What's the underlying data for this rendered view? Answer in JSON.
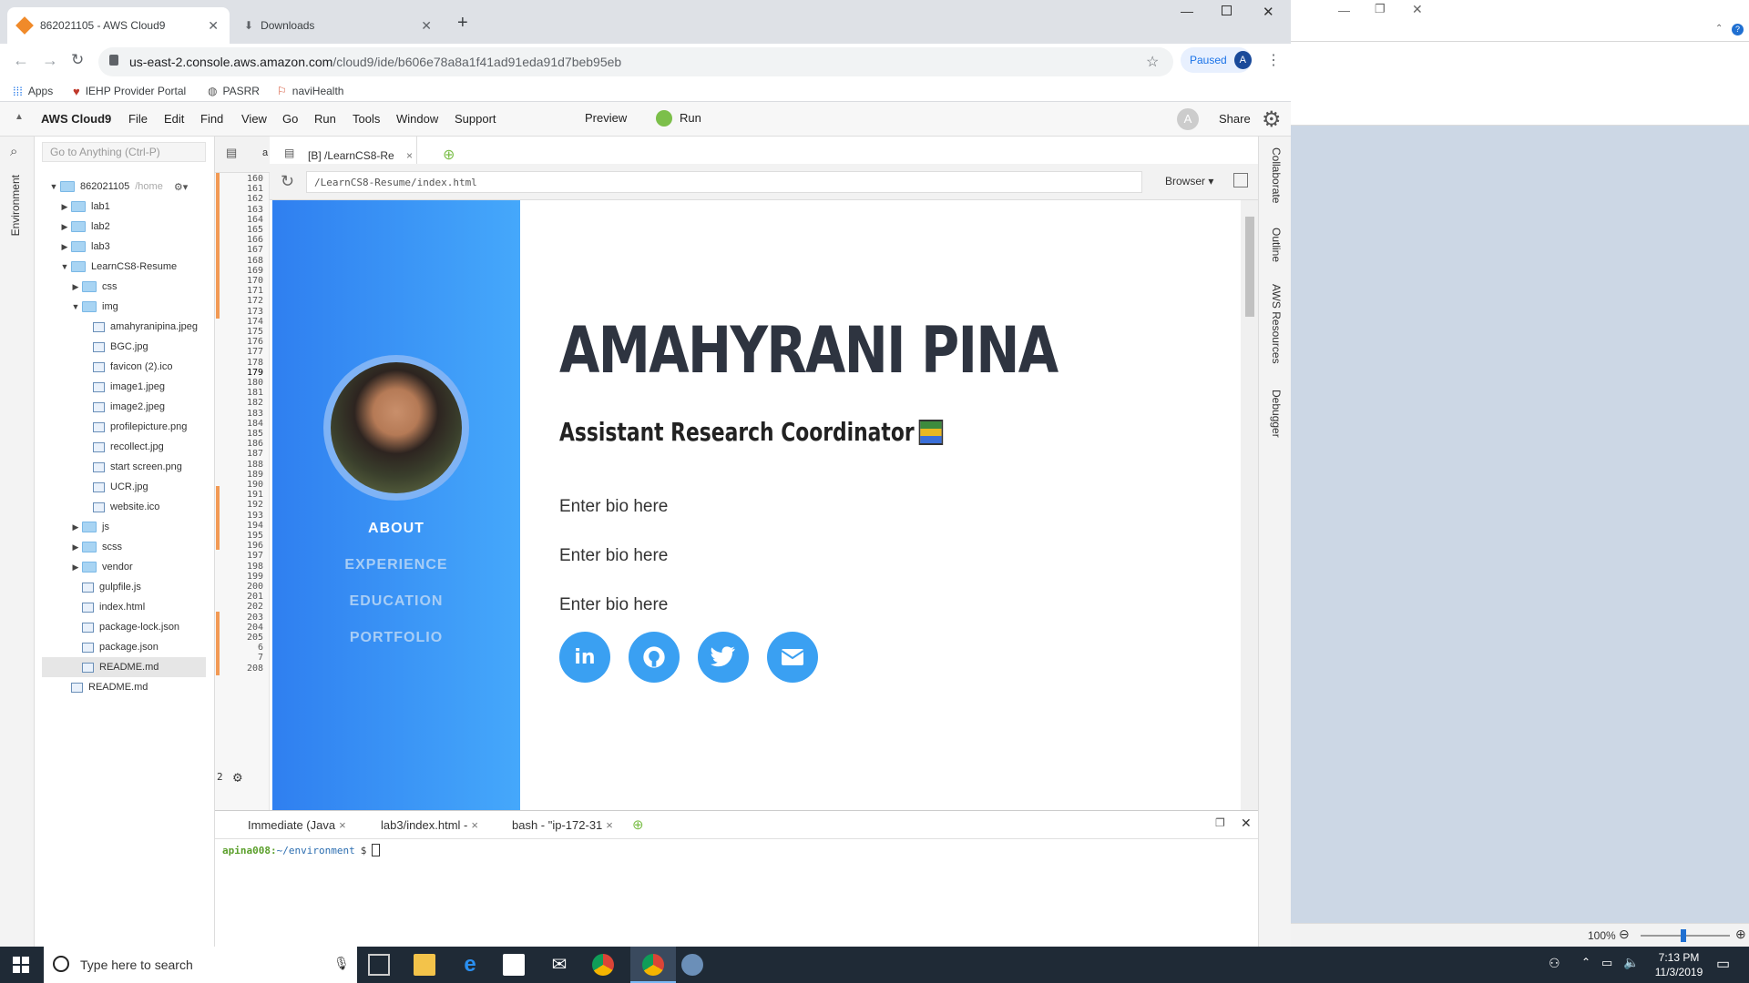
{
  "browser": {
    "tabs": [
      {
        "label": "862021105 - AWS Cloud9",
        "active": true
      },
      {
        "label": "Downloads",
        "active": false
      }
    ],
    "url_host": "us-east-2.console.aws.amazon.com",
    "url_path": "/cloud9/ide/b606e78a8a1f41ad91eda91d7beb95eb",
    "profile_status": "Paused",
    "profile_initial": "A",
    "bookmarks": [
      "Apps",
      "IEHP Provider Portal",
      "PASRR",
      "naviHealth"
    ]
  },
  "ide": {
    "brand": "AWS Cloud9",
    "menu": [
      "File",
      "Edit",
      "Find",
      "View",
      "Go",
      "Run",
      "Tools",
      "Window",
      "Support"
    ],
    "preview_label": "Preview",
    "run_label": "Run",
    "share_label": "Share",
    "avatar_initial": "A",
    "search_placeholder": "Go to Anything (Ctrl-P)",
    "environment_label": "Environment",
    "right_panel": [
      "Collaborate",
      "Outline",
      "AWS Resources",
      "Debugger"
    ],
    "editor_tab_a": "a",
    "editor_tab": "[B] /LearnCS8-Re",
    "preview_url": "/LearnCS8-Resume/index.html",
    "browser_dropdown": "Browser",
    "tree": {
      "root": "862021105",
      "root_path": "/home",
      "items": [
        {
          "label": "lab1",
          "type": "folder",
          "depth": 1,
          "state": "closed"
        },
        {
          "label": "lab2",
          "type": "folder",
          "depth": 1,
          "state": "closed"
        },
        {
          "label": "lab3",
          "type": "folder",
          "depth": 1,
          "state": "closed"
        },
        {
          "label": "LearnCS8-Resume",
          "type": "folder",
          "depth": 1,
          "state": "open"
        },
        {
          "label": "css",
          "type": "folder",
          "depth": 2,
          "state": "closed"
        },
        {
          "label": "img",
          "type": "folder",
          "depth": 2,
          "state": "open"
        },
        {
          "label": "amahyranipina.jpeg",
          "type": "file",
          "depth": 3
        },
        {
          "label": "BGC.jpg",
          "type": "file",
          "depth": 3
        },
        {
          "label": "favicon (2).ico",
          "type": "file",
          "depth": 3
        },
        {
          "label": "image1.jpeg",
          "type": "file",
          "depth": 3
        },
        {
          "label": "image2.jpeg",
          "type": "file",
          "depth": 3
        },
        {
          "label": "profilepicture.png",
          "type": "file",
          "depth": 3
        },
        {
          "label": "recollect.jpg",
          "type": "file",
          "depth": 3
        },
        {
          "label": "start screen.png",
          "type": "file",
          "depth": 3
        },
        {
          "label": "UCR.jpg",
          "type": "file",
          "depth": 3
        },
        {
          "label": "website.ico",
          "type": "file",
          "depth": 3
        },
        {
          "label": "js",
          "type": "folder",
          "depth": 2,
          "state": "closed"
        },
        {
          "label": "scss",
          "type": "folder",
          "depth": 2,
          "state": "closed"
        },
        {
          "label": "vendor",
          "type": "folder",
          "depth": 2,
          "state": "closed"
        },
        {
          "label": "gulpfile.js",
          "type": "file",
          "depth": 2
        },
        {
          "label": "index.html",
          "type": "file",
          "depth": 2
        },
        {
          "label": "package-lock.json",
          "type": "file",
          "depth": 2
        },
        {
          "label": "package.json",
          "type": "file",
          "depth": 2
        },
        {
          "label": "README.md",
          "type": "file",
          "depth": 2,
          "selected": true
        },
        {
          "label": "README.md",
          "type": "file",
          "depth": 1
        }
      ]
    },
    "line_numbers": [
      "160",
      "161",
      "162",
      "163",
      "164",
      "165",
      "166",
      "167",
      "168",
      "169",
      "170",
      "171",
      "172",
      "173",
      "174",
      "175",
      "176",
      "177",
      "178",
      "179",
      "180",
      "181",
      "182",
      "183",
      "184",
      "185",
      "186",
      "187",
      "188",
      "189",
      "190",
      "191",
      "192",
      "193",
      "194",
      "195",
      "196",
      "197",
      "198",
      "199",
      "200",
      "201",
      "202",
      "203",
      "204",
      "205",
      "6",
      "7",
      "208"
    ],
    "gutter_marker": "2",
    "bottom_tabs": [
      "Immediate (Java",
      "lab3/index.html -",
      "bash - \"ip-172-31"
    ],
    "terminal_user": "apina008:",
    "terminal_path": "~/environment",
    "terminal_prompt": "$"
  },
  "resume": {
    "name": "AMAHYRANI PINA",
    "title": "Assistant Research Coordinator",
    "bio": [
      "Enter bio here",
      "Enter bio here",
      "Enter bio here"
    ],
    "nav": [
      {
        "label": "ABOUT",
        "active": true
      },
      {
        "label": "EXPERIENCE",
        "active": false
      },
      {
        "label": "EDUCATION",
        "active": false
      },
      {
        "label": "PORTFOLIO",
        "active": false
      }
    ],
    "social_icons": [
      "linkedin-icon",
      "github-icon",
      "twitter-icon",
      "email-icon"
    ]
  },
  "background_app": {
    "zoom": "100%"
  },
  "taskbar": {
    "search_placeholder": "Type here to search",
    "time": "7:13 PM",
    "date": "11/3/2019"
  },
  "colors": {
    "accent_blue": "#3aa0f2",
    "sidebar_gradient_start": "#2f7ff0",
    "sidebar_gradient_end": "#45a8fb",
    "name_color": "#2e3440",
    "nav_inactive": "#a8cdf5"
  }
}
